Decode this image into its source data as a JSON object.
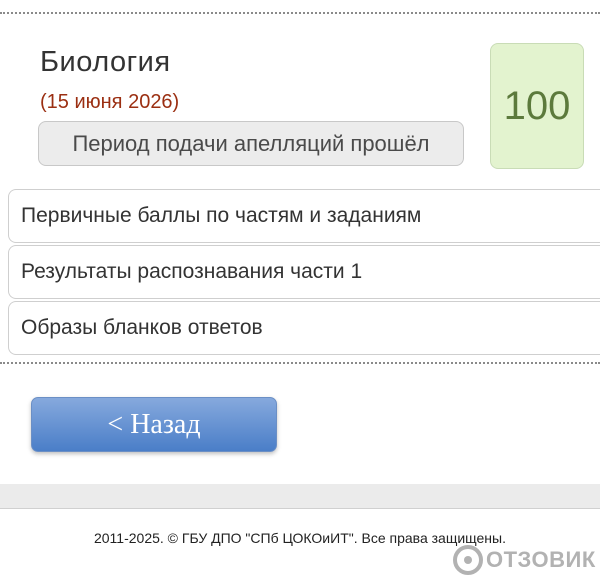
{
  "subject": {
    "title": "Биология",
    "date": "(15 июня 2026)",
    "appeal_status": "Период подачи апелляций прошёл",
    "score": "100"
  },
  "result_links": [
    {
      "label": "Первичные баллы по частям и заданиям"
    },
    {
      "label": "Результаты распознавания части 1"
    },
    {
      "label": "Образы бланков ответов"
    }
  ],
  "back_button": {
    "label": "< Назад"
  },
  "footer": {
    "copyright": "2011-2025. © ГБУ ДПО \"СПб ЦОКОиИТ\". Все права защищены."
  },
  "watermark": {
    "text": "ОТЗОВИК"
  },
  "colors": {
    "date_red": "#9b2f12",
    "score_bg": "#e3f3cf",
    "score_text": "#5c7a3c",
    "button_blue": "#4a7ec8"
  }
}
